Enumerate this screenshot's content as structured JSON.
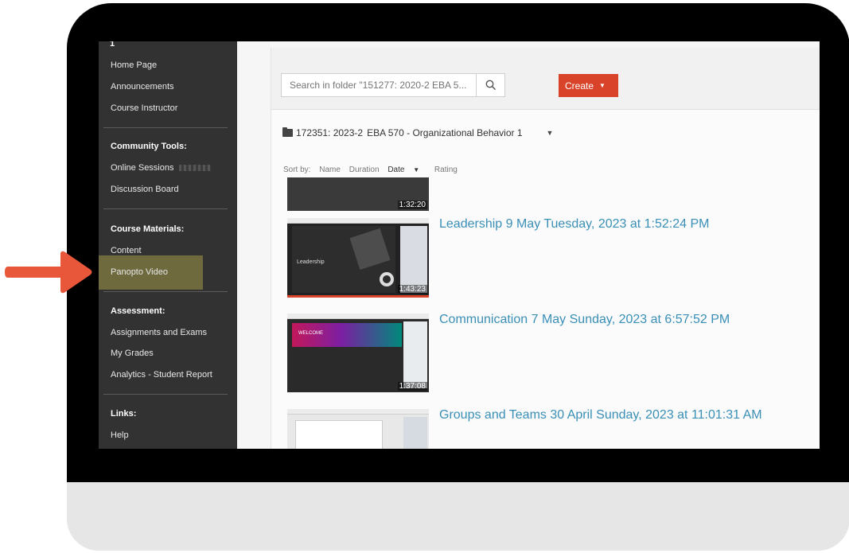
{
  "sidebar": {
    "top_text": "1",
    "items_group1": [
      "Home Page",
      "Announcements",
      "Course Instructor"
    ],
    "community_heading": "Community Tools:",
    "community_items": [
      "Online Sessions",
      "Discussion Board"
    ],
    "materials_heading": "Course Materials:",
    "materials_items": [
      "Content",
      "Panopto Video"
    ],
    "assessment_heading": "Assessment:",
    "assessment_items": [
      "Assignments and Exams",
      "My Grades",
      "Analytics - Student Report"
    ],
    "links_heading": "Links:",
    "links_items": [
      "Help"
    ]
  },
  "toolbar": {
    "search_placeholder": "Search in folder \"151277: 2020-2 EBA 5...",
    "create_label": "Create"
  },
  "folder": {
    "id": "172351: 2023-2",
    "name": "EBA 570 - Organizational Behavior 1"
  },
  "sort": {
    "label": "Sort by:",
    "options": [
      "Name",
      "Duration",
      "Date",
      "Rating"
    ],
    "active": "Date"
  },
  "videos": [
    {
      "title": "",
      "duration": "1:32:20"
    },
    {
      "title": "Leadership 9 May Tuesday, 2023 at 1:52:24 PM",
      "duration": "1:43:23",
      "thumb_text": "Leadership"
    },
    {
      "title": "Communication 7 May Sunday, 2023 at 6:57:52 PM",
      "duration": "1:37:08",
      "thumb_text": "WELCOME"
    },
    {
      "title": "Groups and Teams 30 April Sunday, 2023 at 11:01:31 AM",
      "duration": ""
    }
  ],
  "colors": {
    "accent": "#d8432a",
    "link": "#3a8fb7",
    "sidebar_bg": "#323232",
    "highlight": "#6e6a3e",
    "arrow": "#e8573a"
  },
  "icons": [
    "search-icon",
    "folder-icon",
    "arrow-pointer-icon"
  ]
}
